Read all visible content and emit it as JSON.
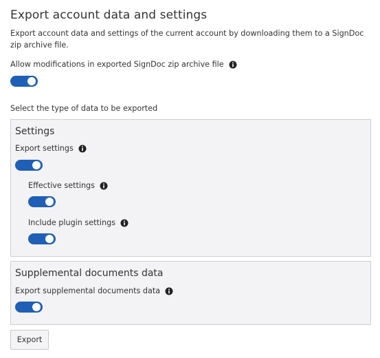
{
  "page": {
    "title": "Export account data and settings",
    "description": "Export account data and settings of the current account by downloading them to a SignDoc zip archive file."
  },
  "allow_modifications": {
    "label": "Allow modifications in exported SignDoc zip archive file",
    "enabled": true
  },
  "select_type_label": "Select the type of data to be exported",
  "settings_panel": {
    "title": "Settings",
    "export_settings": {
      "label": "Export settings",
      "enabled": true
    },
    "effective_settings": {
      "label": "Effective settings",
      "enabled": true
    },
    "include_plugin_settings": {
      "label": "Include plugin settings",
      "enabled": true
    }
  },
  "supplemental_panel": {
    "title": "Supplemental documents data",
    "export_supplemental": {
      "label": "Export supplemental documents data",
      "enabled": true
    }
  },
  "export_button": {
    "label": "Export"
  },
  "colors": {
    "toggle_on": "#1f5fb5",
    "panel_bg": "#f3f3f6",
    "panel_border": "#cfcfd4"
  },
  "icons": {
    "info": "info-icon"
  }
}
